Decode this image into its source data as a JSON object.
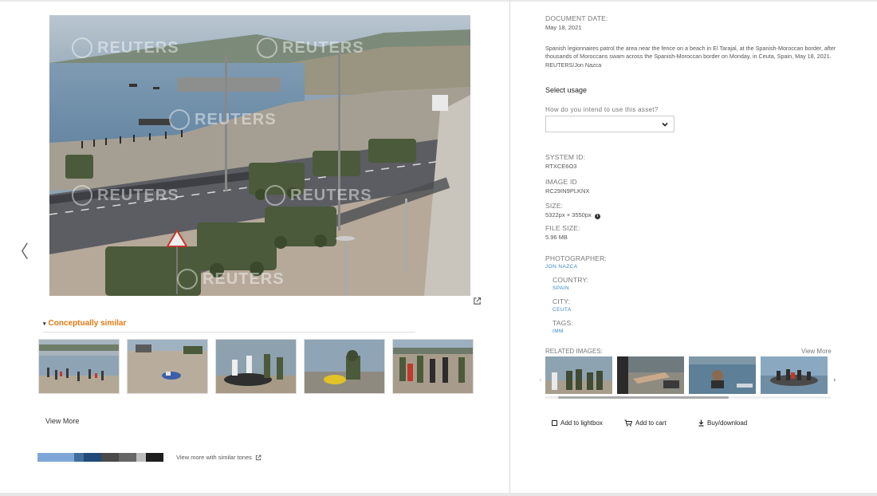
{
  "nav": {
    "prev_arrow": "〈"
  },
  "photo": {
    "watermark": "REUTERS"
  },
  "similar": {
    "heading": "Conceptually similar",
    "caret": "▾",
    "view_more": "View More",
    "tones_link": "View more with similar tones",
    "tones": [
      "#7fa6d8",
      "#3f6e9e",
      "#1f4a7a",
      "#4a4a4a",
      "#666666",
      "#8a8a8a",
      "#bdbdbd",
      "#1e1e1e"
    ]
  },
  "details": {
    "document_date_label": "DOCUMENT DATE:",
    "document_date": "May 18, 2021",
    "caption": "Spanish legionnaires patrol the area near the fence on a beach in El Tarajal, at the Spanish-Moroccan border, after thousands of Moroccans swam across the Spanish-Moroccan border on Monday, in Ceuta, Spain, May 18, 2021. REUTERS/Jon Nazca",
    "select_usage": "Select usage",
    "usage_question": "How do you intend to use this asset?",
    "usage_value": "",
    "system_id_label": "SYSTEM ID:",
    "system_id": "RTXCE6O3",
    "image_id_label": "IMAGE ID",
    "image_id": "RC29IN9PLKNX",
    "size_label": "SIZE:",
    "size": "5322px × 3550px",
    "file_size_label": "FILE SIZE:",
    "file_size": "5.96 MB",
    "photographer_label": "PHOTOGRAPHER:",
    "photographer": "JON NAZCA",
    "country_label": "COUNTRY:",
    "country": "SPAIN",
    "city_label": "CITY:",
    "city": "CEUTA",
    "tags_label": "TAGS:",
    "tags": "IMM"
  },
  "related": {
    "label": "RELATED IMAGES:",
    "view_more": "View More"
  },
  "actions": {
    "lightbox": "Add to lightbox",
    "cart": "Add to cart",
    "download": "Buy/download"
  }
}
